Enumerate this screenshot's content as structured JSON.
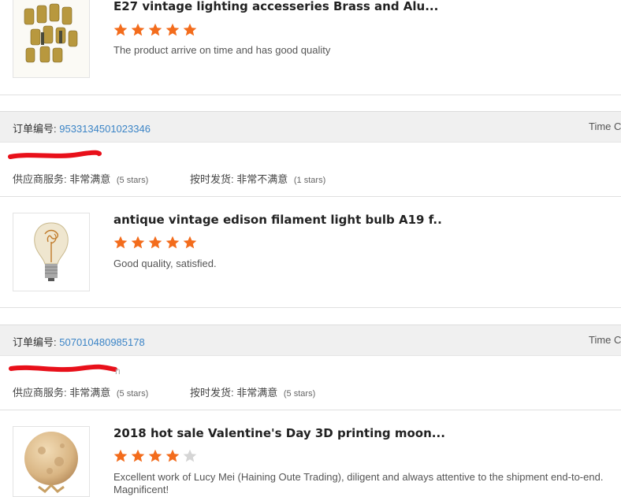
{
  "products": [
    {
      "title": "E27 vintage lighting accesseries Brass and Alu...",
      "rating": 5,
      "review": "The product arrive on time and has good quality"
    },
    {
      "title": "antique vintage edison filament light bulb A19 f..",
      "rating": 5,
      "review": "Good quality, satisfied."
    },
    {
      "title": "2018 hot sale Valentine's Day 3D printing moon...",
      "rating": 4,
      "review": "Excellent work of Lucy Mei (Haining Oute Trading), diligent and always attentive to the shipment end-to-end.",
      "review_line2": "Magnificent!"
    }
  ],
  "orders": [
    {
      "label": "订单编号:",
      "number": "9533134501023346",
      "time_label": "Time C",
      "supplier_label": "供应商服务:",
      "supplier_value": "非常满意",
      "supplier_stars": "(5 stars)",
      "shipping_label": "按时发货:",
      "shipping_value": "非常不满意",
      "shipping_stars": "(1 stars)"
    },
    {
      "label": "订单编号:",
      "number": "507010480985178",
      "time_label": "Time C",
      "supplier_label": "供应商服务:",
      "supplier_value": "非常满意",
      "supplier_stars": "(5 stars)",
      "shipping_label": "按时发货:",
      "shipping_value": "非常满意",
      "shipping_stars": "(5 stars)",
      "buyer_partial": "n"
    }
  ],
  "colors": {
    "star_filled": "#f36c1c",
    "star_empty": "#d5d5d5",
    "order_link": "#3b84c6",
    "redaction": "#e8101a"
  }
}
